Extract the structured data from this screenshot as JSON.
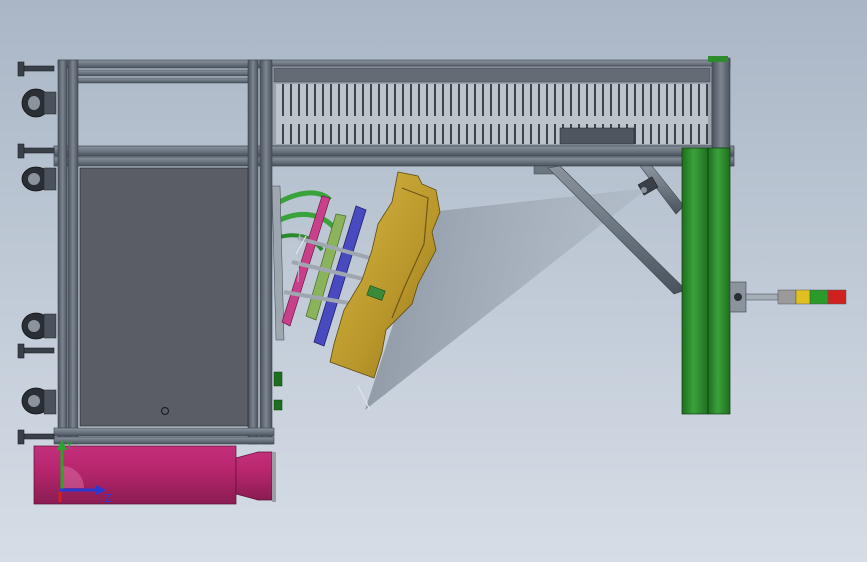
{
  "viewport": {
    "background_top": "#aab6c6",
    "background_bottom": "#d6dde6"
  },
  "model": {
    "frame_color": "#6c7681",
    "frame_dark": "#3d4550",
    "panel_color": "#5a5e64",
    "fixture_color": "#c7a533",
    "green_column_color": "#2e8b2e",
    "magenta_cylinder_color": "#b8266e",
    "plate_colors": [
      "#c9408a",
      "#8ab35c",
      "#4a4ac0"
    ],
    "signal_tower_colors": [
      "#9a9a9a",
      "#e0c020",
      "#2a9a2a",
      "#d02020"
    ]
  },
  "triad": {
    "y_label": "Y",
    "z_label": "Z",
    "y_color": "#2aa52a",
    "z_color": "#2a3ad0"
  }
}
